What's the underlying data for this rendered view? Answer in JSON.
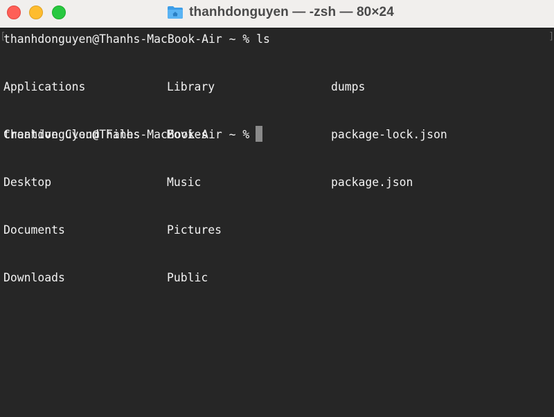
{
  "window": {
    "title": "thanhdonguyen — -zsh — 80×24",
    "title_icon": "home-folder-icon",
    "traffic_lights": [
      "close",
      "minimize",
      "maximize"
    ]
  },
  "terminal": {
    "lines": [
      "thanhdonguyen@Thanhs-MacBook-Air ~ % ls"
    ],
    "ls_columns": [
      [
        "Applications",
        "Creative Cloud Files",
        "Desktop",
        "Documents",
        "Downloads"
      ],
      [
        "Library",
        "Movies",
        "Music",
        "Pictures",
        "Public"
      ],
      [
        "dumps",
        "package-lock.json",
        "package.json"
      ]
    ],
    "prompt": "thanhdonguyen@Thanhs-MacBook-Air ~ % ",
    "mark_left": "[",
    "mark_right": "]"
  },
  "colors": {
    "background": "#262626",
    "foreground": "#f2f2f2",
    "titlebar": "#f1efed",
    "cursor": "#8a8a8a"
  }
}
